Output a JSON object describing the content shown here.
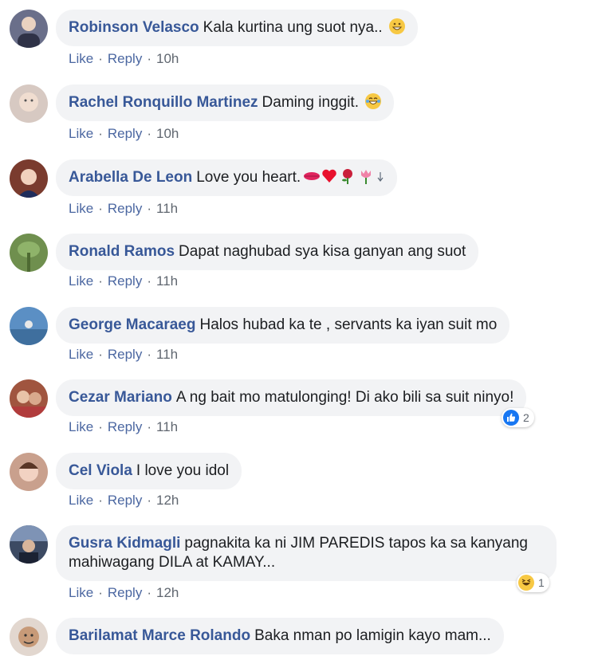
{
  "actions": {
    "like": "Like",
    "reply": "Reply",
    "separator": "·"
  },
  "comments": [
    {
      "name": "Robinson Velasco",
      "text": "Kala kurtina ung suot nya..",
      "time": "10h",
      "avatar_color": "#6a6f8a"
    },
    {
      "name": "Rachel Ronquillo Martinez",
      "text": "Daming inggit.",
      "time": "10h",
      "avatar_color": "#d7c9c2"
    },
    {
      "name": "Arabella De Leon",
      "text": "Love you heart.",
      "time": "11h",
      "avatar_color": "#7a3b2e"
    },
    {
      "name": "Ronald Ramos",
      "text": "Dapat naghubad sya kisa ganyan ang suot",
      "time": "11h",
      "avatar_color": "#6f8f4e"
    },
    {
      "name": "George Macaraeg",
      "text": "Halos hubad ka te , servants ka iyan suit mo",
      "time": "11h",
      "avatar_color": "#5b8fc4"
    },
    {
      "name": "Cezar Mariano",
      "text": "A ng bait mo matulonging! Di ako bili sa suit ninyo!",
      "time": "11h",
      "avatar_color": "#a0553f",
      "reaction": {
        "type": "like",
        "count": "2"
      }
    },
    {
      "name": "Cel Viola",
      "text": "I love you idol",
      "time": "12h",
      "avatar_color": "#c9a08d"
    },
    {
      "name": "Gusra Kidmagli",
      "text": "pagnakita ka ni JIM PAREDIS tapos ka sa kanyang mahiwagang DILA at KAMAY...",
      "time": "12h",
      "avatar_color": "#3c4a63",
      "reaction": {
        "type": "haha",
        "count": "1"
      }
    },
    {
      "name": "Barilamat Marce Rolando",
      "text": "Baka nman po lamigin kayo mam...",
      "time": "",
      "avatar_color": "#e2d7cf"
    }
  ],
  "colors": {
    "name": "#385898",
    "link": "#4b67a1",
    "bubble": "#f2f3f5",
    "like_blue": "#1877f2",
    "haha_yellow": "#f7c843"
  }
}
